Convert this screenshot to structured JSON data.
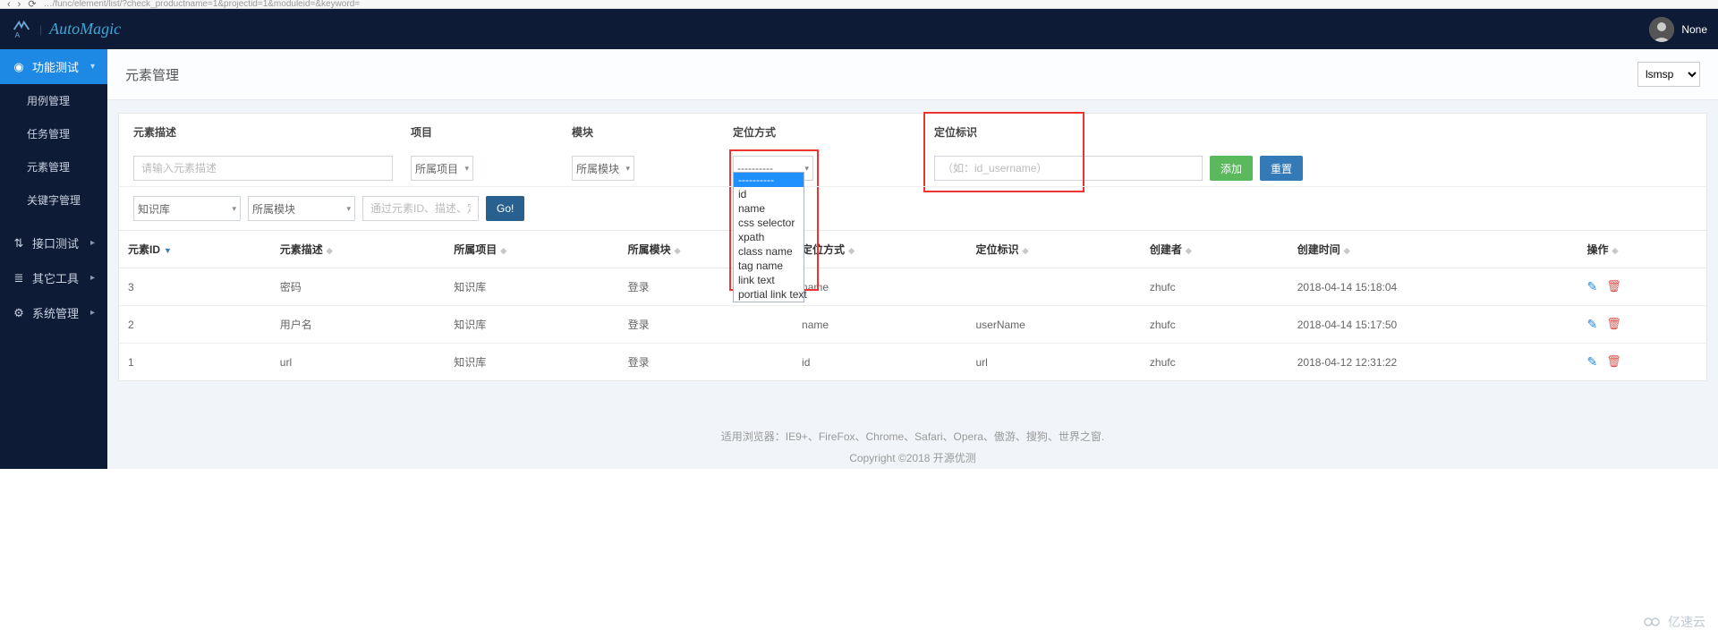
{
  "browser": {
    "url_fragment": "…/func/element/list/?check_productname=1&projectid=1&moduleid=&keyword="
  },
  "header": {
    "brand": "AutoMagic",
    "username": "None"
  },
  "sidebar": {
    "top": {
      "icon": "gauge",
      "label": "功能测试",
      "chev": "▾"
    },
    "subs": [
      {
        "label": "用例管理"
      },
      {
        "label": "任务管理"
      },
      {
        "label": "元素管理"
      },
      {
        "label": "关键字管理"
      }
    ],
    "others": [
      {
        "icon": "transfer",
        "label": "接口测试",
        "chev": "▸"
      },
      {
        "icon": "stack",
        "label": "其它工具",
        "chev": "▸"
      },
      {
        "icon": "gear",
        "label": "系统管理",
        "chev": "▸"
      }
    ]
  },
  "page": {
    "title": "元素管理",
    "top_select": "lsmsp",
    "filters": {
      "desc_label": "元素描述",
      "desc_placeholder": "请输入元素描述",
      "project_label": "项目",
      "project_value": "所属项目",
      "module_label": "模块",
      "module_value": "所属模块",
      "locate_label": "定位方式",
      "locate_value": "----------",
      "ident_label": "定位标识",
      "ident_placeholder": "（如：id_username）",
      "add_btn": "添加",
      "reset_btn": "重置"
    },
    "dropdown_options": [
      "----------",
      "id",
      "name",
      "css selector",
      "xpath",
      "class name",
      "tag name",
      "link text",
      "portial link text"
    ],
    "search": {
      "sel1": "知识库",
      "sel2": "所属模块",
      "input_placeholder": "通过元素ID、描述、定位标识搜索",
      "go": "Go!"
    },
    "columns": [
      "元素ID",
      "元素描述",
      "所属项目",
      "所属模块",
      "定位方式",
      "定位标识",
      "创建者",
      "创建时间",
      "操作"
    ],
    "rows": [
      {
        "id": "3",
        "desc": "密码",
        "project": "知识库",
        "module": "登录",
        "locate": "name",
        "ident": "",
        "creator": "zhufc",
        "ctime": "2018-04-14 15:18:04"
      },
      {
        "id": "2",
        "desc": "用户名",
        "project": "知识库",
        "module": "登录",
        "locate": "name",
        "ident": "userName",
        "creator": "zhufc",
        "ctime": "2018-04-14 15:17:50"
      },
      {
        "id": "1",
        "desc": "url",
        "project": "知识库",
        "module": "登录",
        "locate": "id",
        "ident": "url",
        "creator": "zhufc",
        "ctime": "2018-04-12 12:31:22"
      }
    ]
  },
  "footer": {
    "line1": "适用浏览器：IE9+、FireFox、Chrome、Safari、Opera、傲游、搜狗、世界之窗.",
    "line2": "Copyright ©2018 开源优测"
  },
  "watermark": "亿速云"
}
